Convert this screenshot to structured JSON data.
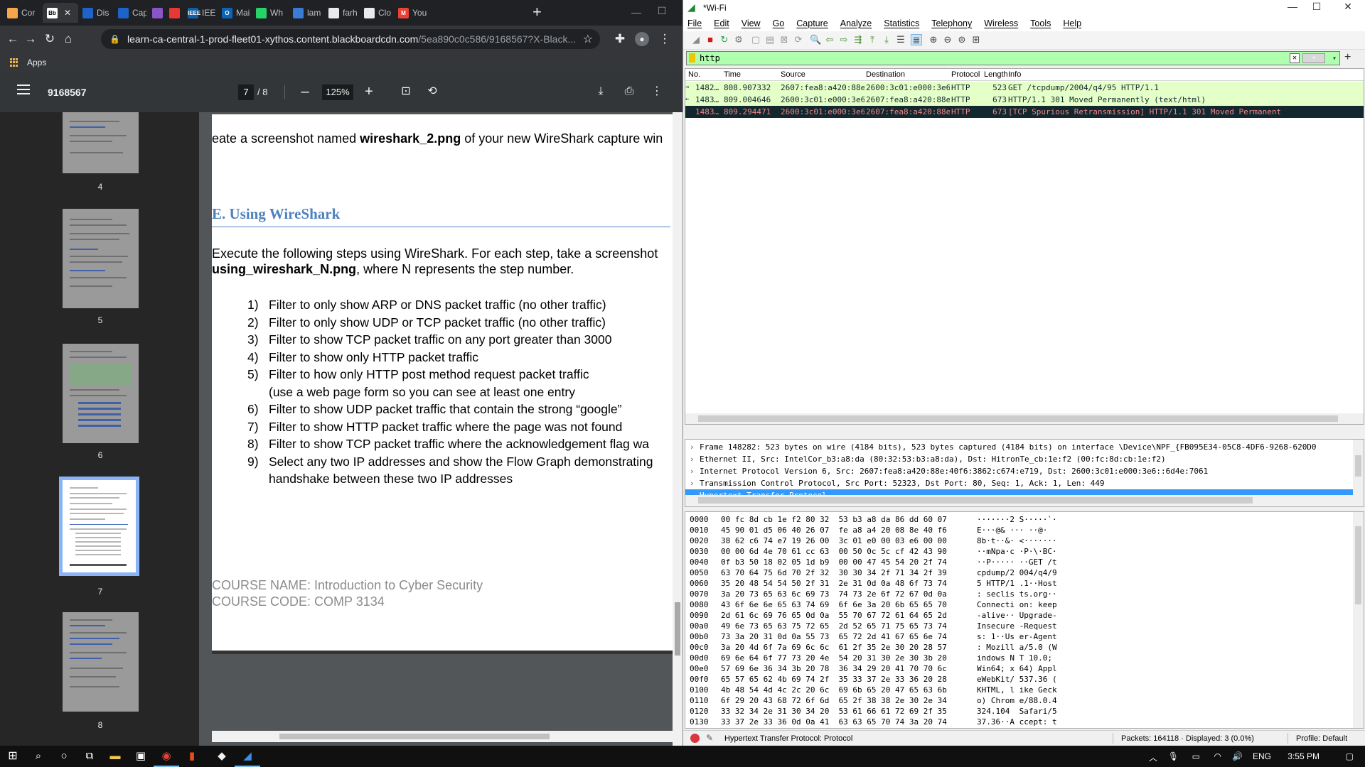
{
  "chrome": {
    "tabs": [
      {
        "label": "Cor",
        "fav_color": "#f7a64a",
        "fav_text": ""
      },
      {
        "label": "",
        "fav_color": "#ffffff",
        "fav_text": "Bb",
        "active": true
      },
      {
        "label": "Dis",
        "fav_color": "#1e63c9",
        "fav_text": ""
      },
      {
        "label": "Cap",
        "fav_color": "#1e63c9",
        "fav_text": ""
      },
      {
        "label": "",
        "fav_color": "#8a55c9",
        "fav_text": ""
      },
      {
        "label": "",
        "fav_color": "#e53935",
        "fav_text": ""
      },
      {
        "label": "IEEE",
        "fav_color": "#0f5ea8",
        "fav_text": "IEEE"
      },
      {
        "label": "Mai",
        "fav_color": "#0a64b8",
        "fav_text": "O"
      },
      {
        "label": "Wh",
        "fav_color": "#25d366",
        "fav_text": ""
      },
      {
        "label": "lam",
        "fav_color": "#3a7bd5",
        "fav_text": ""
      },
      {
        "label": "farh",
        "fav_color": "#e8eaed",
        "fav_text": ""
      },
      {
        "label": "Clo",
        "fav_color": "#e8eaed",
        "fav_text": ""
      },
      {
        "label": "You",
        "fav_color": "#ea4335",
        "fav_text": "M"
      }
    ],
    "url_host": "learn-ca-central-1-prod-fleet01-xythos.content.blackboardcdn.com",
    "url_path": "/5ea890c0c586/9168567?X-Black...",
    "bookmarks_label": "Apps"
  },
  "pdf": {
    "title": "9168567",
    "page_current": "7",
    "page_total": "/  8",
    "zoom": "125%",
    "thumb_labels": [
      "4",
      "5",
      "6",
      "7",
      "8"
    ],
    "line_screenshot_pre": "eate a screenshot named ",
    "line_screenshot_bold": "wireshark_2.png",
    "line_screenshot_post": " of your new WireShark capture win",
    "heading": "E. Using WireShark",
    "intro_line1": "Execute the following steps using WireShark. For each step, take a screenshot",
    "intro_bold": "using_wireshark_N.png",
    "intro_line2_post": ", where N represents the step number.",
    "steps": [
      {
        "num": "1)",
        "text": "Filter to only show ARP or DNS packet traffic (no other traffic)"
      },
      {
        "num": "2)",
        "text": "Filter to only show UDP or TCP packet traffic (no other traffic)"
      },
      {
        "num": "3)",
        "text": "Filter to show TCP packet traffic on any port greater than 3000"
      },
      {
        "num": "4)",
        "text": "Filter to show only HTTP packet traffic"
      },
      {
        "num": "5)",
        "text": "Filter to how only HTTP post method request packet traffic"
      },
      {
        "num": "",
        "text": "(use a web page form so you can see at least one entry"
      },
      {
        "num": "6)",
        "text": "Filter to show UDP packet traffic that contain the strong “google”"
      },
      {
        "num": "7)",
        "text": "Filter to show HTTP packet traffic where the page was not found"
      },
      {
        "num": "8)",
        "text": "Filter to show TCP packet traffic where the acknowledgement flag wa"
      },
      {
        "num": "9)",
        "text": "Select any two IP addresses and show the Flow Graph demonstrating"
      },
      {
        "num": "",
        "text": "handshake between these two IP addresses"
      }
    ],
    "footer_line1": "COURSE NAME: Introduction to Cyber Security",
    "footer_line2": "COURSE CODE: COMP 3134"
  },
  "wireshark": {
    "window_title": "*Wi-Fi",
    "menu": [
      "File",
      "Edit",
      "View",
      "Go",
      "Capture",
      "Analyze",
      "Statistics",
      "Telephony",
      "Wireless",
      "Tools",
      "Help"
    ],
    "filter": "http",
    "columns": [
      "No.",
      "Time",
      "Source",
      "Destination",
      "Protocol",
      "Length",
      "Info"
    ],
    "packets": [
      {
        "no": "1482…",
        "time": "808.907332",
        "src": "2607:fea8:a420:88e:…",
        "dst": "2600:3c01:e000:3e6:…",
        "proto": "HTTP",
        "len": "523",
        "info": "GET /tcpdump/2004/q4/95 HTTP/1.1",
        "bg": "#e4ffc7",
        "fg": "#12272e",
        "marker": "→"
      },
      {
        "no": "1483…",
        "time": "809.004646",
        "src": "2600:3c01:e000:3e6:…",
        "dst": "2607:fea8:a420:88e:…",
        "proto": "HTTP",
        "len": "673",
        "info": "HTTP/1.1 301 Moved Permanently  (text/html)",
        "bg": "#e4ffc7",
        "fg": "#12272e",
        "marker": "←"
      },
      {
        "no": "1483…",
        "time": "809.294471",
        "src": "2600:3c01:e000:3e6:…",
        "dst": "2607:fea8:a420:88e:…",
        "proto": "HTTP",
        "len": "673",
        "info": "[TCP Spurious Retransmission] HTTP/1.1 301 Moved Permanent",
        "bg": "#12272e",
        "fg": "#f78787",
        "marker": ""
      }
    ],
    "details": [
      "Frame 148282: 523 bytes on wire (4184 bits), 523 bytes captured (4184 bits) on interface \\Device\\NPF_{FB095E34-05C8-4DF6-9268-620D0",
      "Ethernet II, Src: IntelCor_b3:a8:da (80:32:53:b3:a8:da), Dst: HitronTe_cb:1e:f2 (00:fc:8d:cb:1e:f2)",
      "Internet Protocol Version 6, Src: 2607:fea8:a420:88e:40f6:3862:c674:e719, Dst: 2600:3c01:e000:3e6::6d4e:7061",
      "Transmission Control Protocol, Src Port: 52323, Dst Port: 80, Seq: 1, Ack: 1, Len: 449",
      "Hypertext Transfer Protocol"
    ],
    "bytes": [
      {
        "off": "0000",
        "hex": "00 fc 8d cb 1e f2 80 32  53 b3 a8 da 86 dd 60 07",
        "asc": "·······2 S·····`·"
      },
      {
        "off": "0010",
        "hex": "45 90 01 d5 06 40 26 07  fe a8 a4 20 08 8e 40 f6",
        "asc": "E···@& ··· ··@·"
      },
      {
        "off": "0020",
        "hex": "38 62 c6 74 e7 19 26 00  3c 01 e0 00 03 e6 00 00",
        "asc": "8b·t··&· <·······"
      },
      {
        "off": "0030",
        "hex": "00 00 6d 4e 70 61 cc 63  00 50 0c 5c cf 42 43 90",
        "asc": "··mNpa·c ·P·\\·BC·"
      },
      {
        "off": "0040",
        "hex": "0f b3 50 18 02 05 1d b9  00 00 47 45 54 20 2f 74",
        "asc": "··P····· ··GET /t"
      },
      {
        "off": "0050",
        "hex": "63 70 64 75 6d 70 2f 32  30 30 34 2f 71 34 2f 39",
        "asc": "cpdump/2 004/q4/9"
      },
      {
        "off": "0060",
        "hex": "35 20 48 54 54 50 2f 31  2e 31 0d 0a 48 6f 73 74",
        "asc": "5 HTTP/1 .1··Host"
      },
      {
        "off": "0070",
        "hex": "3a 20 73 65 63 6c 69 73  74 73 2e 6f 72 67 0d 0a",
        "asc": ": seclis ts.org··"
      },
      {
        "off": "0080",
        "hex": "43 6f 6e 6e 65 63 74 69  6f 6e 3a 20 6b 65 65 70",
        "asc": "Connecti on: keep"
      },
      {
        "off": "0090",
        "hex": "2d 61 6c 69 76 65 0d 0a  55 70 67 72 61 64 65 2d",
        "asc": "-alive·· Upgrade-"
      },
      {
        "off": "00a0",
        "hex": "49 6e 73 65 63 75 72 65  2d 52 65 71 75 65 73 74",
        "asc": "Insecure -Request"
      },
      {
        "off": "00b0",
        "hex": "73 3a 20 31 0d 0a 55 73  65 72 2d 41 67 65 6e 74",
        "asc": "s: 1··Us er-Agent"
      },
      {
        "off": "00c0",
        "hex": "3a 20 4d 6f 7a 69 6c 6c  61 2f 35 2e 30 20 28 57",
        "asc": ": Mozill a/5.0 (W"
      },
      {
        "off": "00d0",
        "hex": "69 6e 64 6f 77 73 20 4e  54 20 31 30 2e 30 3b 20",
        "asc": "indows N T 10.0; "
      },
      {
        "off": "00e0",
        "hex": "57 69 6e 36 34 3b 20 78  36 34 29 20 41 70 70 6c",
        "asc": "Win64; x 64) Appl"
      },
      {
        "off": "00f0",
        "hex": "65 57 65 62 4b 69 74 2f  35 33 37 2e 33 36 20 28",
        "asc": "eWebKit/ 537.36 ("
      },
      {
        "off": "0100",
        "hex": "4b 48 54 4d 4c 2c 20 6c  69 6b 65 20 47 65 63 6b",
        "asc": "KHTML, l ike Geck"
      },
      {
        "off": "0110",
        "hex": "6f 29 20 43 68 72 6f 6d  65 2f 38 38 2e 30 2e 34",
        "asc": "o) Chrom e/88.0.4"
      },
      {
        "off": "0120",
        "hex": "33 32 34 2e 31 30 34 20  53 61 66 61 72 69 2f 35",
        "asc": "324.104  Safari/5"
      },
      {
        "off": "0130",
        "hex": "33 37 2e 33 36 0d 0a 41  63 63 65 70 74 3a 20 74",
        "asc": "37.36··A ccept: t"
      }
    ],
    "status_msg": "Hypertext Transfer Protocol: Protocol",
    "status_packets": "Packets: 164118 · Displayed: 3 (0.0%)",
    "status_profile": "Profile: Default"
  },
  "taskbar": {
    "lang": "ENG",
    "time": "3:55 PM"
  }
}
